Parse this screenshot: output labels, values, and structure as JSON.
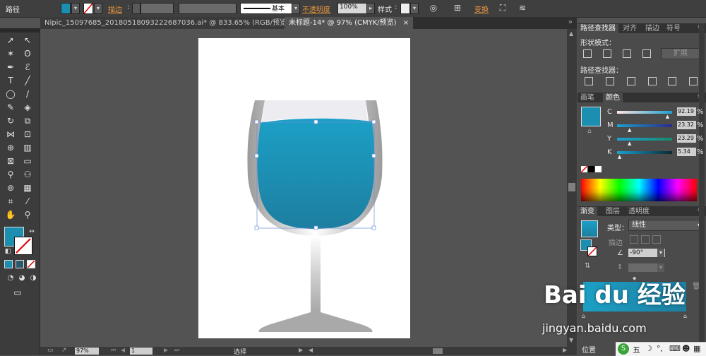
{
  "control_bar": {
    "selection_label": "路径",
    "stroke_label": "描边",
    "stroke_style": "基本",
    "opacity_label": "不透明度",
    "opacity_value": "100%",
    "style_label": "样式",
    "transform_label": "变换"
  },
  "tabs": [
    {
      "label": "Nipic_15097685_20180518093222687036.ai* @ 833.65% (RGB/预览)",
      "close": "×"
    },
    {
      "label": "未标题-14* @ 97% (CMYK/预览)",
      "close": "×"
    }
  ],
  "panels": {
    "pathfinder": {
      "tabs": [
        "路径查找器",
        "对齐",
        "描边",
        "符号"
      ],
      "shape_modes_label": "形状模式：",
      "expand_label": "扩展",
      "pathfinders_label": "路径查找器："
    },
    "color": {
      "tabs": [
        "画笔",
        "颜色"
      ],
      "fill_color": "#1c8fb1",
      "channels": [
        {
          "label": "C",
          "value": "92.19",
          "unit": "%",
          "level": 0.92
        },
        {
          "label": "M",
          "value": "23.32",
          "unit": "%",
          "level": 0.23
        },
        {
          "label": "Y",
          "value": "23.29",
          "unit": "%",
          "level": 0.23
        },
        {
          "label": "K",
          "value": "5.34",
          "unit": "%",
          "level": 0.05
        }
      ]
    },
    "gradient": {
      "tabs": [
        "渐变",
        "图层",
        "透明度"
      ],
      "type_label": "类型：",
      "type_value": "线性",
      "stroke_label": "描边",
      "angle_value": "-90°",
      "location_label": "位置"
    }
  },
  "status_bar": {
    "zoom": "97%",
    "artboard": "1",
    "tool_status": "选择"
  },
  "watermark": {
    "brand": "Bai du 经验",
    "url": "jingyan.baidu.com"
  },
  "ime": "五"
}
